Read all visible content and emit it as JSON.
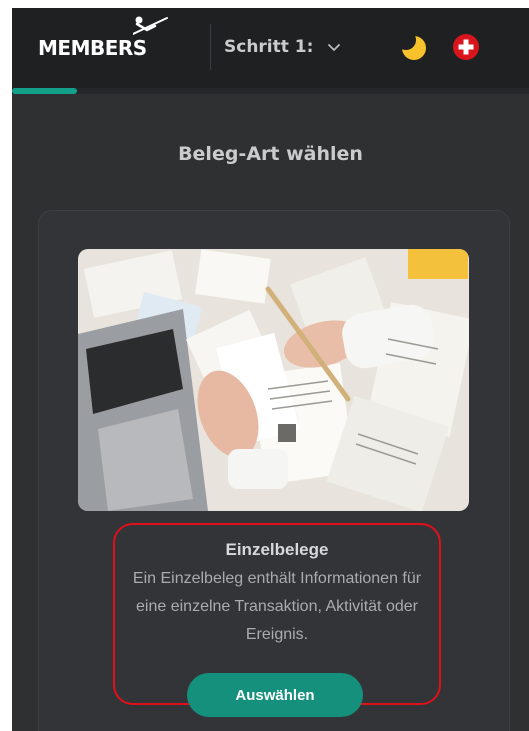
{
  "header": {
    "logo_text": "MEMBERS",
    "step_select": {
      "label": "Schritt 1:"
    },
    "theme_icon": "moon-icon",
    "language_icon": "swiss-flag-icon",
    "progress_fraction": 0.25
  },
  "main": {
    "title": "Beleg-Art wählen",
    "card": {
      "image_icon": "receipts-photo",
      "title": "Einzelbelege",
      "description": "Ein Einzelbeleg enthält Informationen für eine einzelne Transaktion, Aktivität oder Ereignis.",
      "button_label": "Auswählen"
    }
  },
  "colors": {
    "accent": "#15907d",
    "highlight": "#e0101b",
    "background": "#2f3032",
    "header": "#1f2021"
  }
}
